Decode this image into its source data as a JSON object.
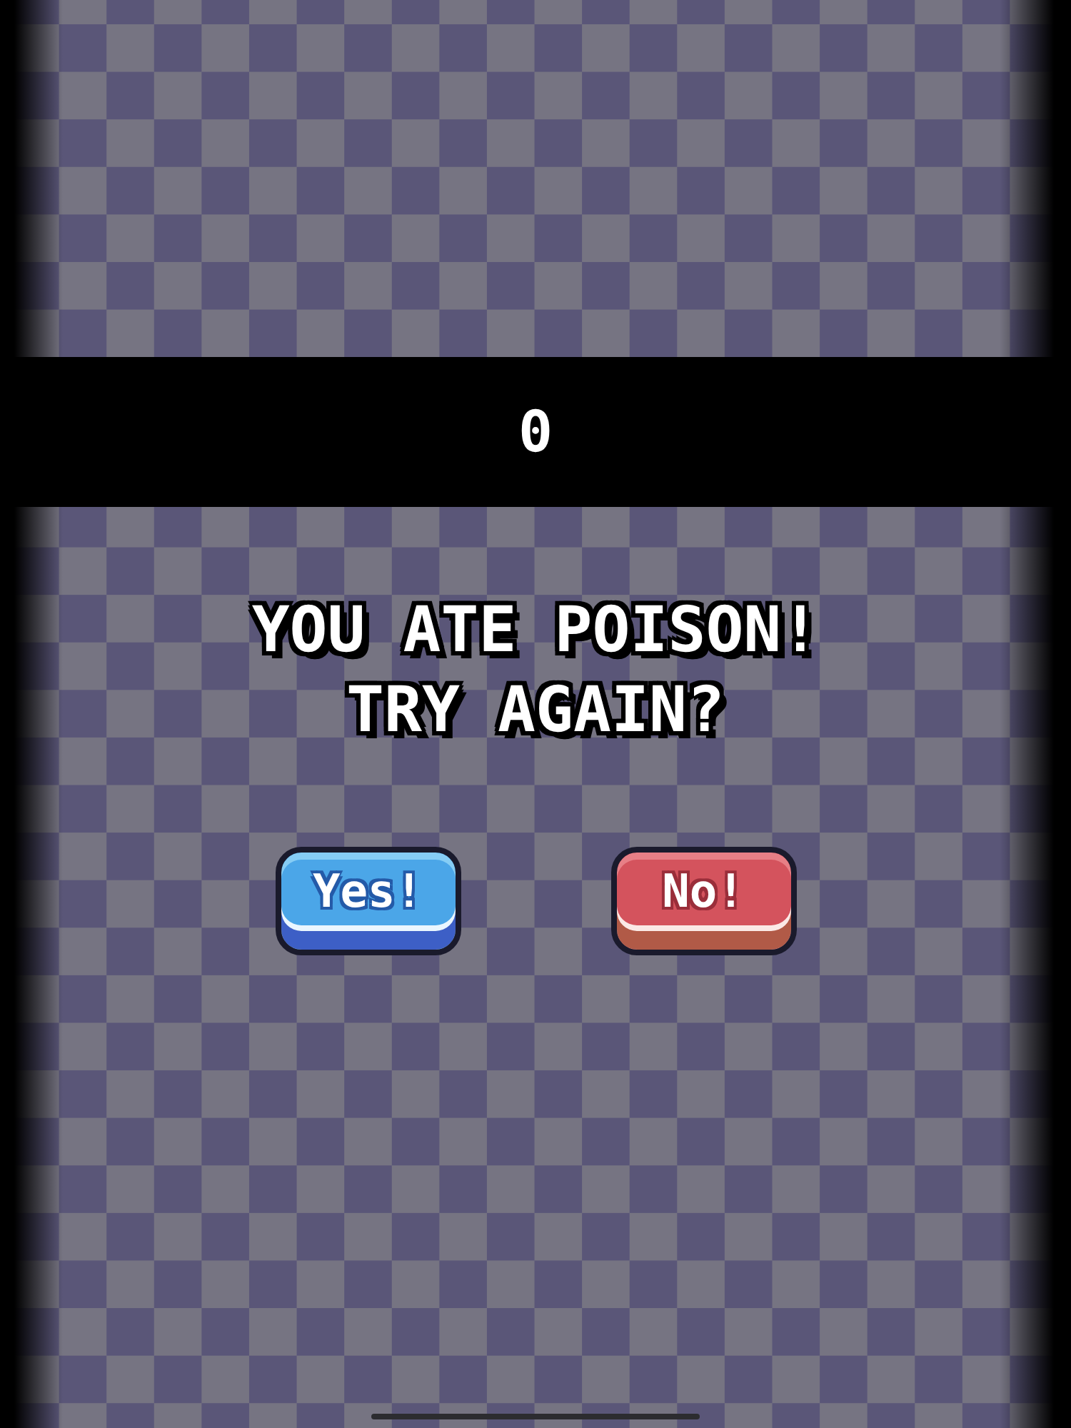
{
  "score": {
    "value": "0"
  },
  "message": {
    "title": "YOU ATE POISON!",
    "prompt": "TRY AGAIN?"
  },
  "buttons": [
    {
      "label": "Yes!",
      "kind": "confirm"
    },
    {
      "label": "No!",
      "kind": "cancel"
    }
  ]
}
